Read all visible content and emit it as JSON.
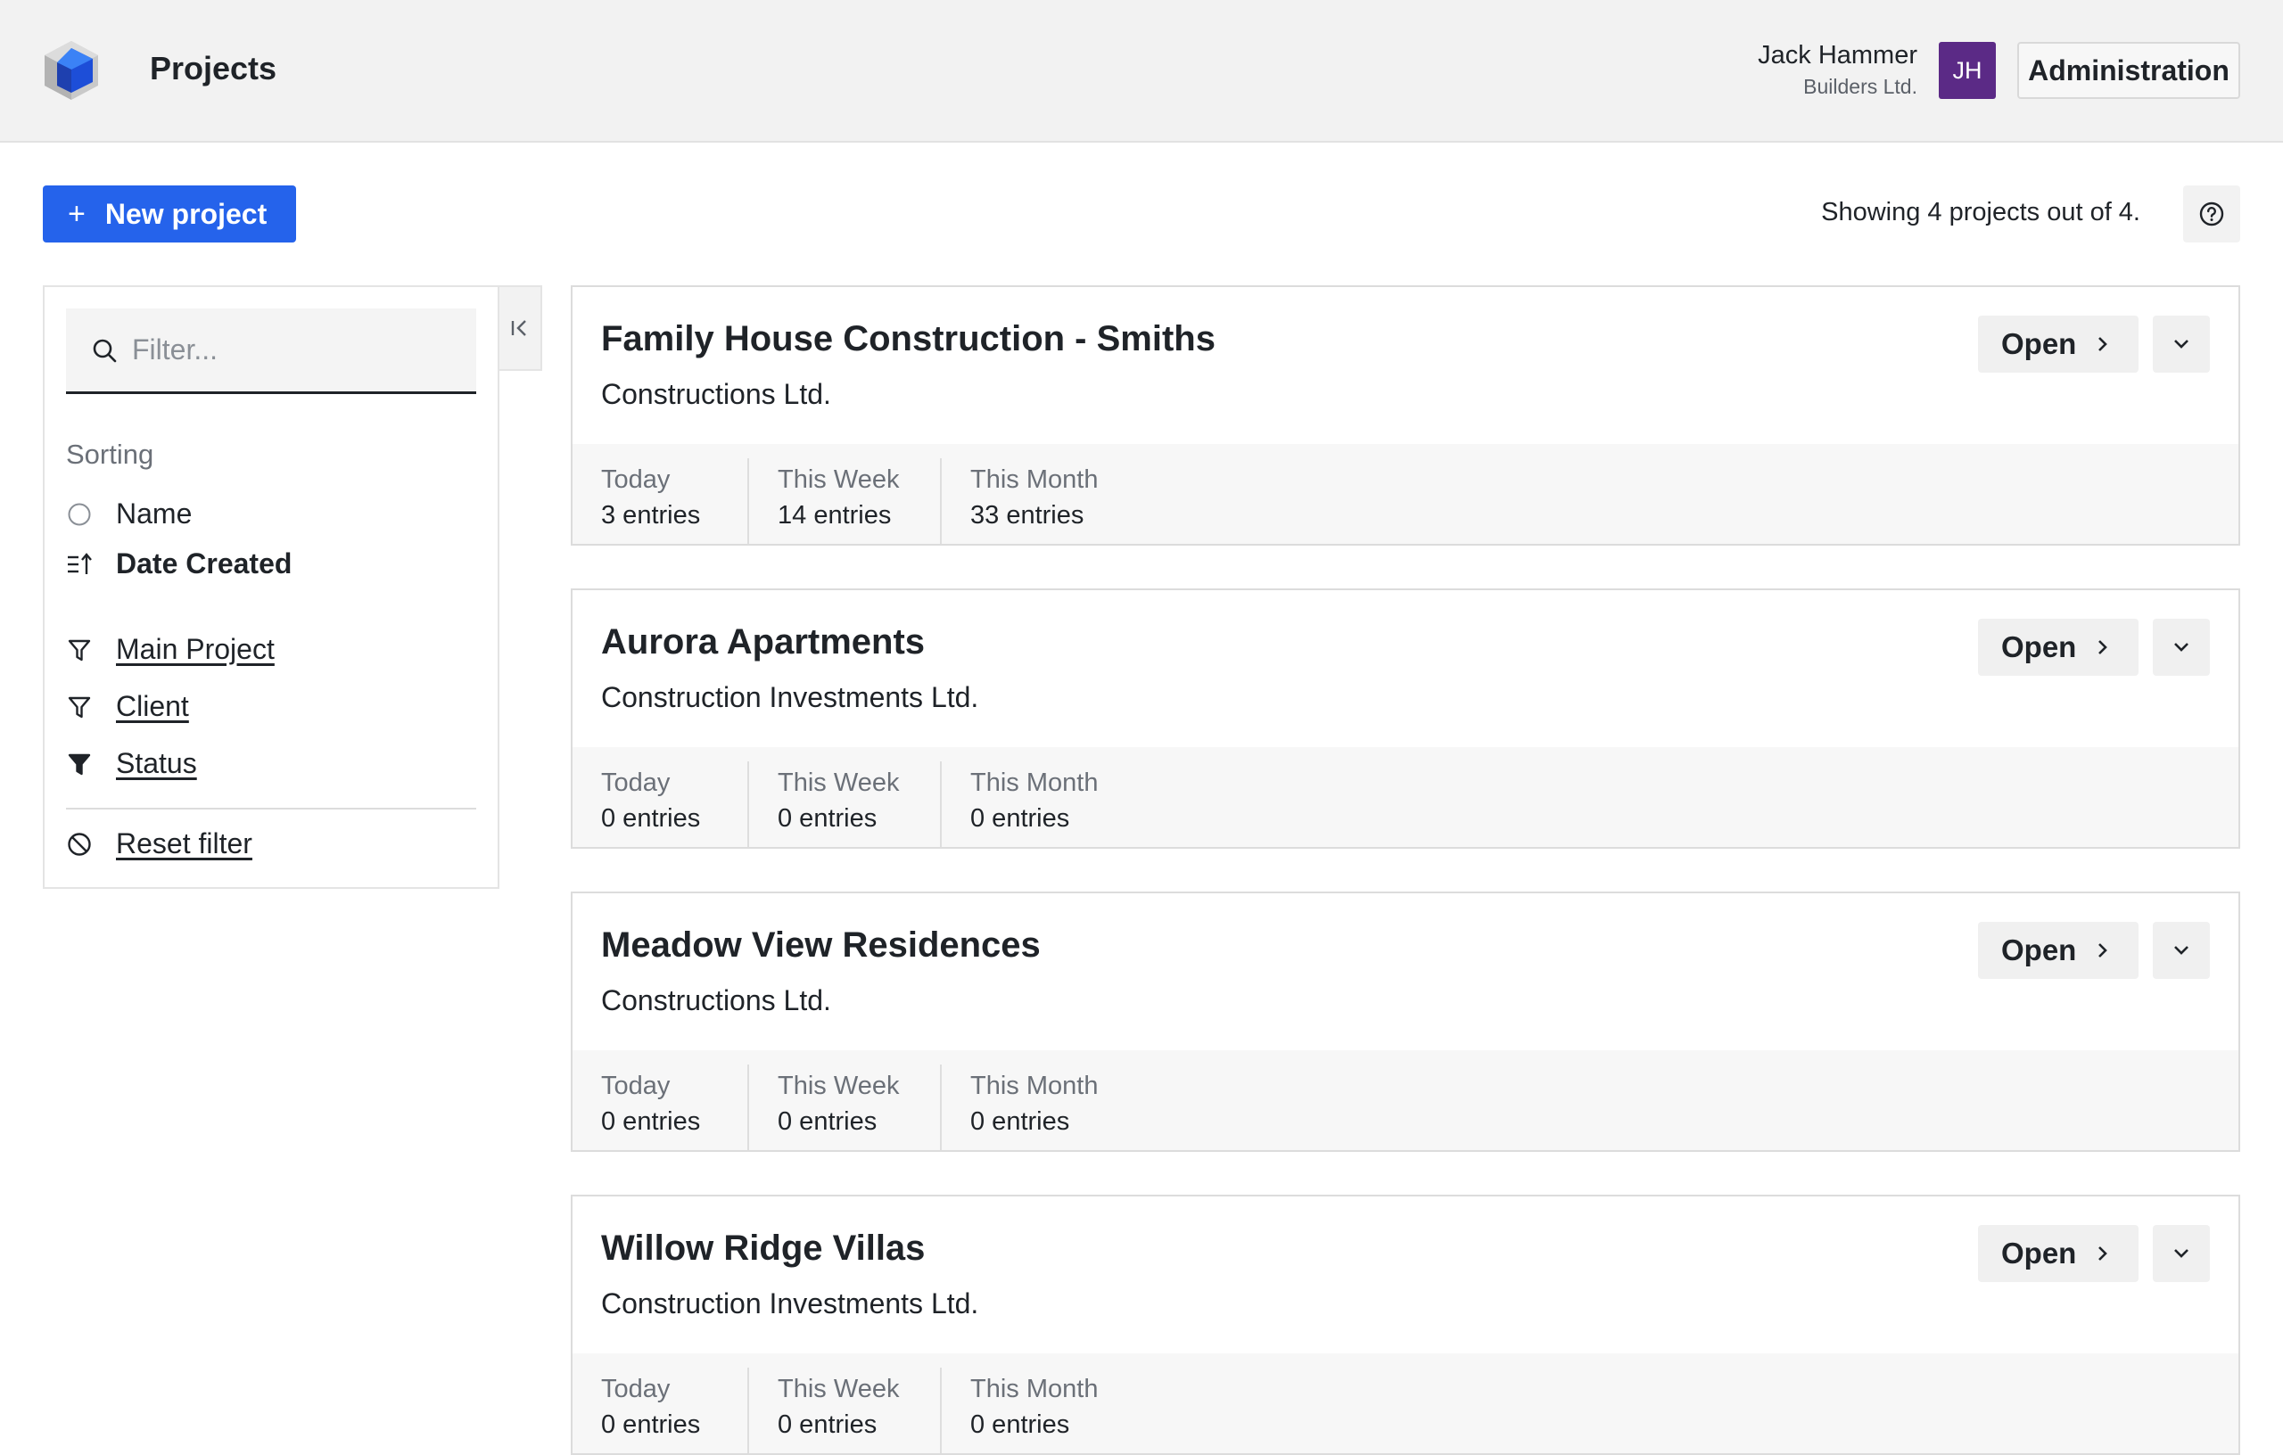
{
  "header": {
    "title": "Projects",
    "user_name": "Jack Hammer",
    "user_company": "Builders Ltd.",
    "avatar_initials": "JH",
    "admin_label": "Administration"
  },
  "toolbar": {
    "new_project_label": "New project",
    "showing_text": "Showing 4 projects out of 4."
  },
  "sidebar": {
    "filter_placeholder": "Filter...",
    "sorting_heading": "Sorting",
    "sort_name": "Name",
    "sort_date_created": "Date Created",
    "filter_main_project": "Main Project",
    "filter_client": "Client",
    "filter_status": "Status",
    "reset_filter": "Reset filter"
  },
  "card_labels": {
    "open": "Open",
    "today": "Today",
    "this_week": "This Week",
    "this_month": "This Month"
  },
  "projects": [
    {
      "name": "Family House Construction - Smiths",
      "client": "Constructions Ltd.",
      "today": "3 entries",
      "week": "14 entries",
      "month": "33 entries"
    },
    {
      "name": "Aurora Apartments",
      "client": "Construction Investments Ltd.",
      "today": "0 entries",
      "week": "0 entries",
      "month": "0 entries"
    },
    {
      "name": "Meadow View Residences",
      "client": "Constructions Ltd.",
      "today": "0 entries",
      "week": "0 entries",
      "month": "0 entries"
    },
    {
      "name": "Willow Ridge Villas",
      "client": "Construction Investments Ltd.",
      "today": "0 entries",
      "week": "0 entries",
      "month": "0 entries"
    }
  ],
  "colors": {
    "primary": "#2563eb",
    "avatar": "#5b2a86",
    "header_bg": "#f2f2f2"
  }
}
